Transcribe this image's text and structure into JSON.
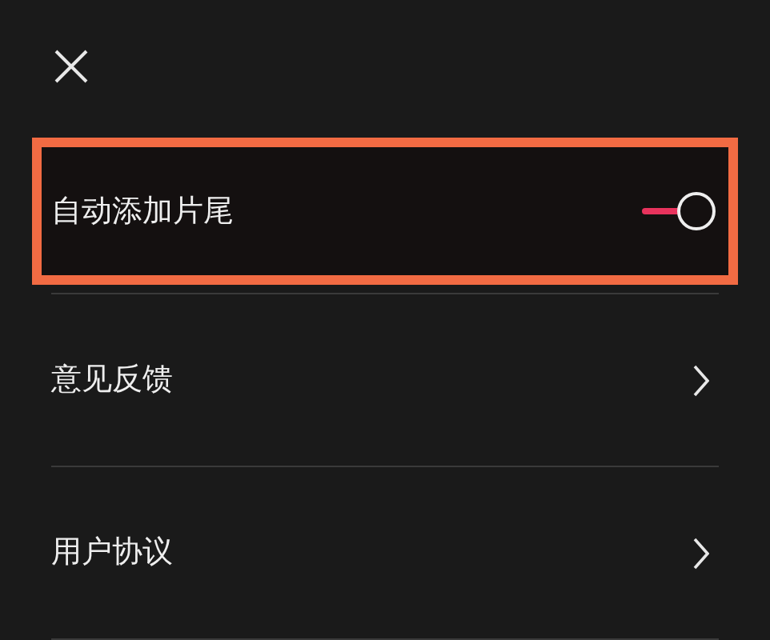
{
  "items": [
    {
      "kind": "toggle",
      "label": "自动添加片尾",
      "on": true,
      "highlighted": true
    },
    {
      "kind": "link",
      "label": "意见反馈",
      "highlighted": false
    },
    {
      "kind": "link",
      "label": "用户协议",
      "highlighted": false
    }
  ]
}
